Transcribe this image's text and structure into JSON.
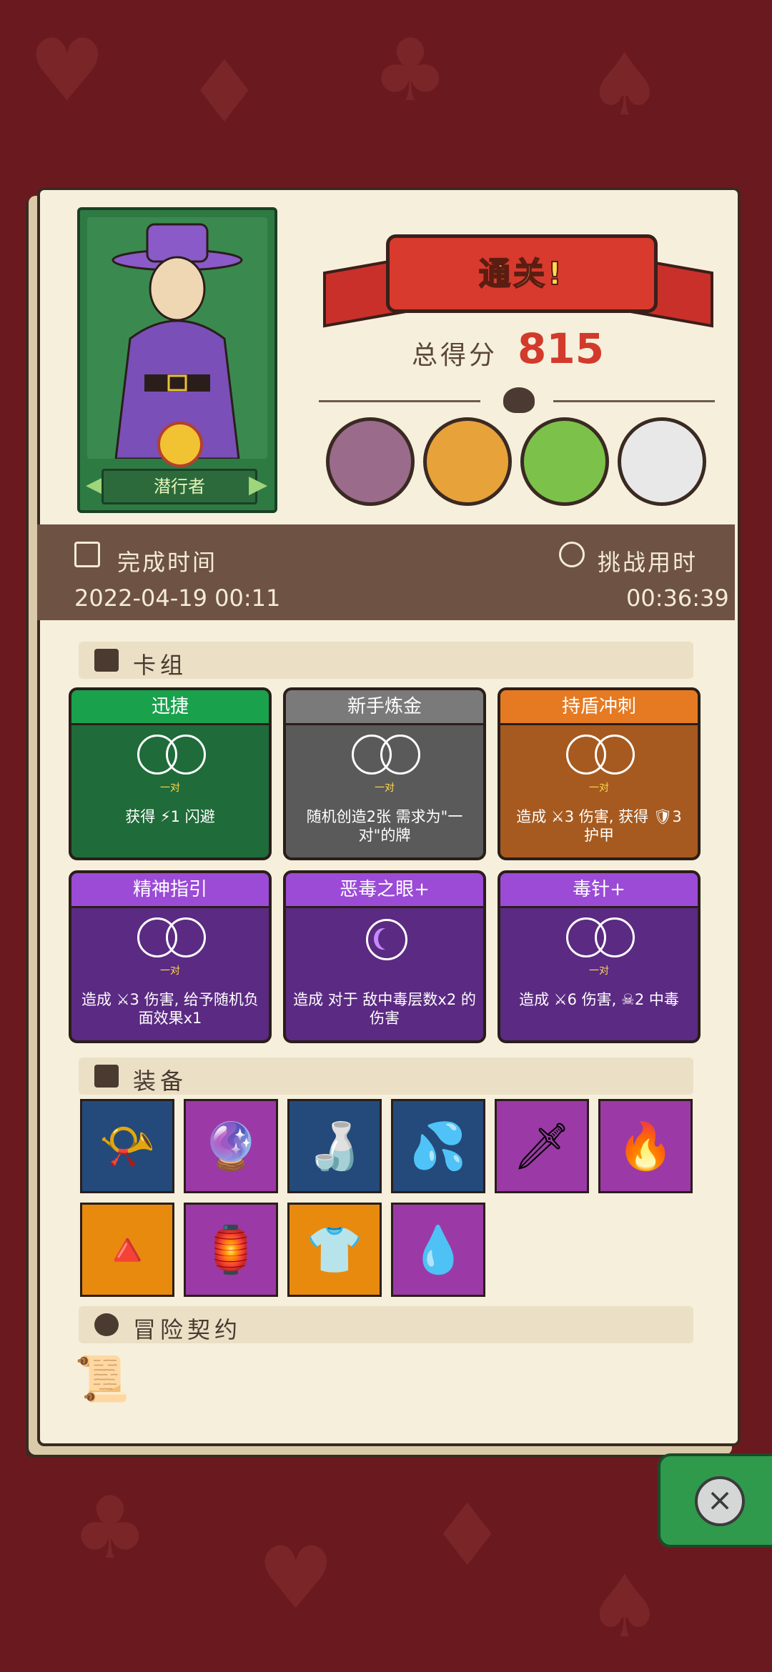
{
  "result": {
    "banner": "通关!",
    "score_label": "总得分",
    "score": "815"
  },
  "hero": {
    "name": "潜行者"
  },
  "bosses": [
    "boss-1",
    "boss-2",
    "boss-3",
    "boss-4"
  ],
  "time": {
    "complete_label": "完成时间",
    "complete_value": "2022-04-19 00:11",
    "duration_label": "挑战用时",
    "duration_value": "00:36:39"
  },
  "deck": {
    "label": "卡组",
    "cards": [
      {
        "title": "迅捷",
        "sub": "一对",
        "desc": "获得 ⚡1 闪避",
        "color": "#1f6b3a",
        "header": "#1aa14c"
      },
      {
        "title": "新手炼金",
        "sub": "一对",
        "desc": "随机创造2张 需求为\"一对\"的牌",
        "color": "#5a5a5a",
        "header": "#7a7a7a"
      },
      {
        "title": "持盾冲刺",
        "sub": "一对",
        "desc": "造成 ⚔3 伤害, 获得 🛡3 护甲",
        "color": "#a65a1f",
        "header": "#e67a22"
      },
      {
        "title": "精神指引",
        "sub": "一对",
        "desc": "造成 ⚔3 伤害, 给予随机负面效果x1",
        "color": "#5b2a82",
        "header": "#9b4bd6"
      },
      {
        "title": "恶毒之眼+",
        "sub": "",
        "desc": "造成 对于 敌中毒层数x2 的伤害",
        "color": "#5b2a82",
        "header": "#9b4bd6"
      },
      {
        "title": "毒针+",
        "sub": "一对",
        "desc": "造成 ⚔6 伤害, ☠2 中毒",
        "color": "#5b2a82",
        "header": "#9b4bd6"
      }
    ]
  },
  "equipment": {
    "label": "装备",
    "items": [
      {
        "icon": "horn",
        "glyph": "📯",
        "bg": "blue"
      },
      {
        "icon": "crystal-shell",
        "glyph": "🔮",
        "bg": "purple"
      },
      {
        "icon": "broken-bottle",
        "glyph": "🍶",
        "bg": "blue"
      },
      {
        "icon": "purple-splash",
        "glyph": "💦",
        "bg": "blue"
      },
      {
        "icon": "red-scroll-dagger",
        "glyph": "🗡",
        "bg": "purple"
      },
      {
        "icon": "fire-dagger",
        "glyph": "🔥",
        "bg": "purple"
      },
      {
        "icon": "eye-pyramid-flask",
        "glyph": "🔺",
        "bg": "orange"
      },
      {
        "icon": "heart-lantern",
        "glyph": "🏮",
        "bg": "purple"
      },
      {
        "icon": "orange-sweater",
        "glyph": "👕",
        "bg": "orange"
      },
      {
        "icon": "blue-flame-spirit",
        "glyph": "💧",
        "bg": "purple"
      }
    ]
  },
  "contract": {
    "label": "冒险契约",
    "icon": "scroll"
  },
  "close": "×"
}
